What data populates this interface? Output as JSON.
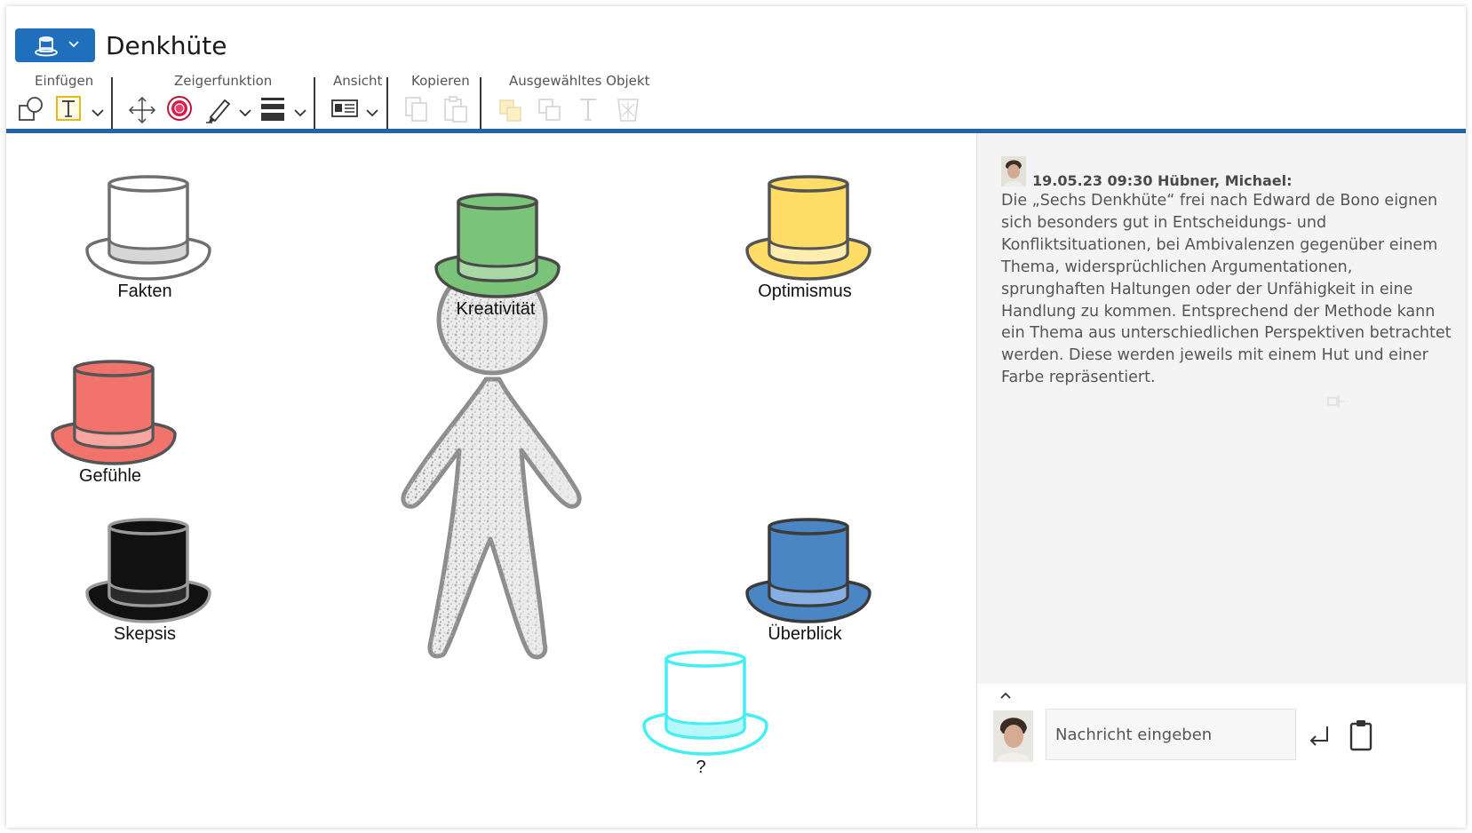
{
  "header": {
    "app_icon": "top-hat-icon",
    "title": "Denkhüte"
  },
  "toolbar": {
    "groups": {
      "insert": "Einfügen",
      "pointer": "Zeigerfunktion",
      "view": "Ansicht",
      "copy": "Kopieren",
      "selected": "Ausgewähltes Objekt"
    },
    "accent_color": "#1e63ad"
  },
  "canvas": {
    "hats": [
      {
        "label": "Fakten",
        "color": "#ffffff"
      },
      {
        "label": "Kreativität",
        "color": "#7ac47a"
      },
      {
        "label": "Optimismus",
        "color": "#ffdd66"
      },
      {
        "label": "Gefühle",
        "color": "#f2726c"
      },
      {
        "label": "Skepsis",
        "color": "#111111"
      },
      {
        "label": "Überblick",
        "color": "#4a86c4"
      },
      {
        "label": "?",
        "color": "#55f0f5"
      }
    ]
  },
  "comments": [
    {
      "timestamp": "19.05.23 09:30",
      "author": "Hübner, Michael:",
      "text": "Die „Sechs Denkhüte“ frei nach Edward de Bono eignen sich besonders gut in Entscheidungs- und Konfliktsituationen, bei Ambivalenzen gegenüber einem Thema, widersprüchlichen Argumentationen, sprunghaften Haltungen oder der Unfähigkeit in eine Handlung zu kommen. Entsprechend der Methode kann ein Thema aus unterschiedlichen Perspektiven betrachtet werden. Diese werden jeweils mit einem Hut und einer Farbe repräsentiert."
    }
  ],
  "composer": {
    "placeholder": "Nachricht eingeben"
  }
}
